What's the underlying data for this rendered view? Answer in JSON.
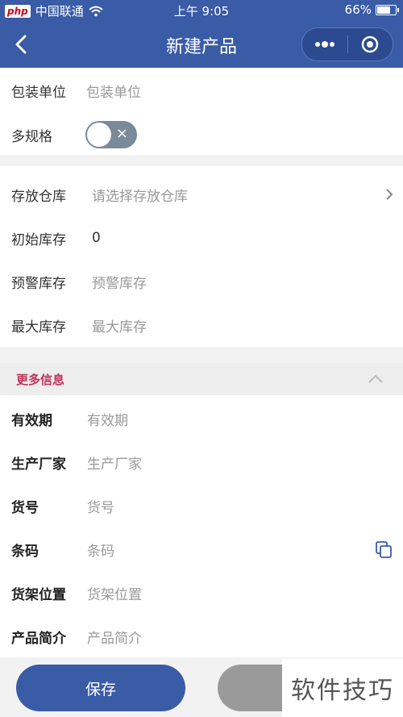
{
  "status_bar": {
    "carrier_logo": "php",
    "carrier": "中国联通",
    "time": "上午 9:05",
    "battery": "66%",
    "battery_fraction": 0.66
  },
  "navbar": {
    "title": "新建产品"
  },
  "section1": {
    "package_unit": {
      "label": "包装单位",
      "placeholder": "包装单位"
    },
    "multi_spec": {
      "label": "多规格",
      "toggle_on": false,
      "toggle_symbol": "×"
    }
  },
  "section2": {
    "warehouse": {
      "label": "存放仓库",
      "placeholder": "请选择存放仓库"
    },
    "initial_stock": {
      "label": "初始库存",
      "value": "0"
    },
    "warning_stock": {
      "label": "预警库存",
      "placeholder": "预警库存"
    },
    "max_stock": {
      "label": "最大库存",
      "placeholder": "最大库存"
    }
  },
  "more": {
    "header": "更多信息",
    "fields": {
      "validity": {
        "label": "有效期",
        "placeholder": "有效期"
      },
      "manufacturer": {
        "label": "生产厂家",
        "placeholder": "生产厂家"
      },
      "item_no": {
        "label": "货号",
        "placeholder": "货号"
      },
      "barcode": {
        "label": "条码",
        "placeholder": "条码"
      },
      "shelf": {
        "label": "货架位置",
        "placeholder": "货架位置"
      },
      "intro": {
        "label": "产品简介",
        "placeholder": "产品简介"
      }
    }
  },
  "bottom": {
    "save_label": "保存"
  },
  "watermark": "软件技巧",
  "colors": {
    "primary": "#3a5ba6",
    "accent_red": "#c0335a"
  },
  "icons": [
    "back-icon",
    "more-dots-icon",
    "target-icon",
    "chevron-right-icon",
    "chevron-up-icon",
    "copy-icon",
    "wifi-icon",
    "battery-icon"
  ]
}
